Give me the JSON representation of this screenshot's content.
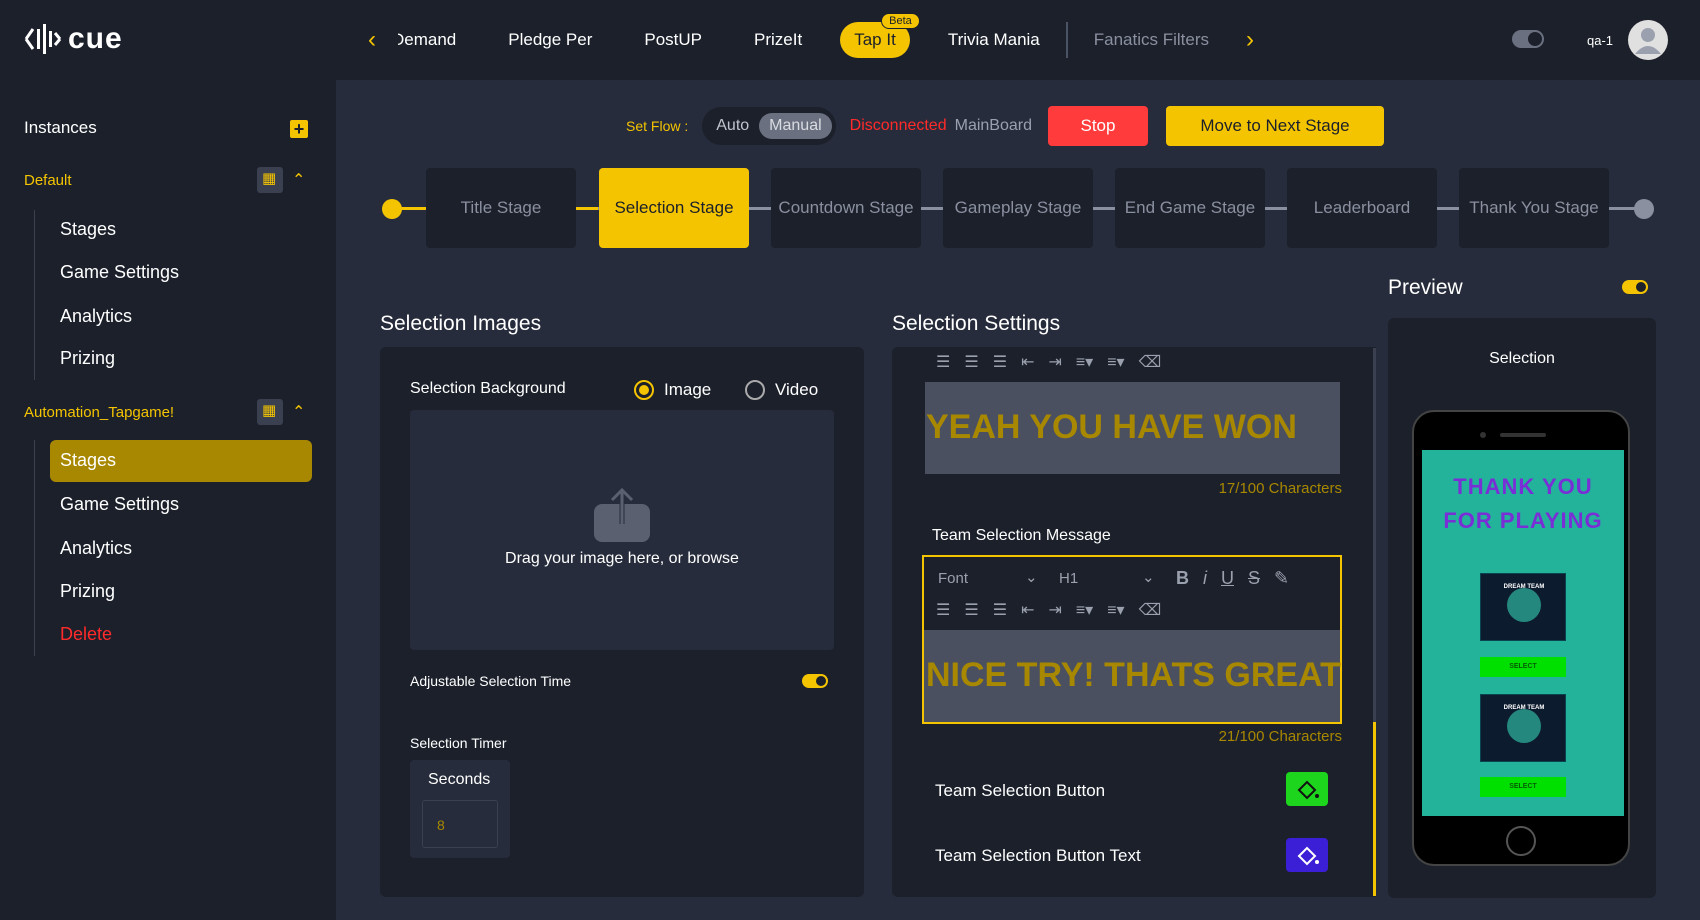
{
  "app": {
    "name": "cue",
    "user": "qa-1"
  },
  "nav": {
    "tabs": [
      {
        "label": "Demand",
        "state": "partial"
      },
      {
        "label": "Pledge Per"
      },
      {
        "label": "PostUP"
      },
      {
        "label": "PrizeIt"
      },
      {
        "label": "Tap It",
        "badge": "Beta",
        "state": "active"
      },
      {
        "label": "Trivia Mania"
      },
      {
        "label": "Fanatics Filters",
        "state": "dim"
      }
    ]
  },
  "sidebar": {
    "heading": "Instances",
    "groups": [
      {
        "name": "Default",
        "items": [
          "Stages",
          "Game Settings",
          "Analytics",
          "Prizing"
        ]
      },
      {
        "name": "Automation_Tapgame!",
        "items": [
          "Stages",
          "Game Settings",
          "Analytics",
          "Prizing",
          "Delete"
        ],
        "active_item": "Stages"
      }
    ]
  },
  "flow": {
    "label": "Set Flow :",
    "options": [
      "Auto",
      "Manual"
    ],
    "selected": "Manual",
    "status": "Disconnected",
    "board": "MainBoard",
    "stop_label": "Stop",
    "next_label": "Move to Next Stage"
  },
  "stages": [
    "Title Stage",
    "Selection Stage",
    "Countdown Stage",
    "Gameplay Stage",
    "End Game Stage",
    "Leaderboard",
    "Thank You Stage"
  ],
  "active_stage": "Selection Stage",
  "selection_images": {
    "title": "Selection Images",
    "background_label": "Selection Background",
    "media_options": [
      "Image",
      "Video"
    ],
    "media_selected": "Image",
    "drop_text": "Drag your image here, or browse",
    "adjustable_label": "Adjustable Selection Time",
    "adjustable_on": true,
    "timer_label": "Selection Timer",
    "seconds_label": "Seconds",
    "seconds_value": "8"
  },
  "selection_settings": {
    "title": "Selection Settings",
    "win_message": "YEAH YOU HAVE WON",
    "win_count": "17/100 Characters",
    "team_msg_label": "Team Selection Message",
    "font_placeholder": "Font",
    "heading_value": "H1",
    "team_message": "NICE TRY! THATS GREAT",
    "team_count": "21/100 Characters",
    "button_label": "Team Selection Button",
    "button_text_label": "Team Selection Button Text",
    "button_color": "#1ed51e",
    "button_text_color": "#3b1fd6"
  },
  "preview": {
    "title": "Preview",
    "enabled": true,
    "screen_label": "Selection",
    "thank_line1": "THANK YOU",
    "thank_line2": "FOR PLAYING",
    "team_name": "DREAM TEAM",
    "select_label": "SELECT"
  }
}
